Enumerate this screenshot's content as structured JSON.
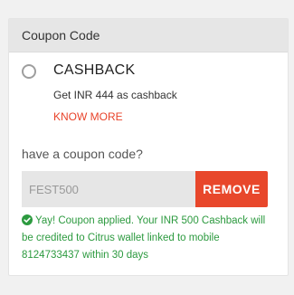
{
  "panel": {
    "title": "Coupon Code"
  },
  "cashback_option": {
    "title": "CASHBACK",
    "description": "Get INR 444 as cashback",
    "know_more": "KNOW MORE"
  },
  "coupon": {
    "prompt": "have a coupon code?",
    "value": "FEST500",
    "remove_label": "REMOVE",
    "success_message": "Yay! Coupon applied. Your INR 500 Cashback will be credited to Citrus wallet linked to mobile 8124733437 within 30 days"
  },
  "icons": {
    "radio": "radio-unselected-icon",
    "success": "check-circle-icon"
  },
  "colors": {
    "accent": "#e8472b",
    "success": "#2c9a3f",
    "header_bg": "#e6e6e6"
  }
}
